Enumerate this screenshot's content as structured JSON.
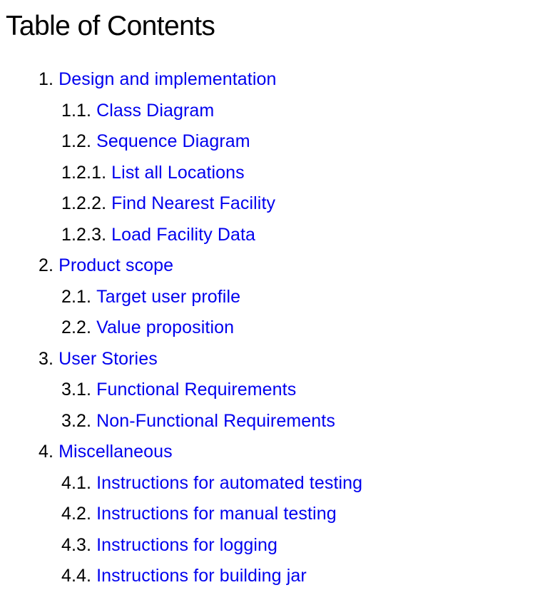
{
  "toc": {
    "title": "Table of Contents",
    "entries": [
      {
        "number": "1.",
        "label": "Design and implementation",
        "level": 1
      },
      {
        "number": "1.1.",
        "label": "Class Diagram",
        "level": 2
      },
      {
        "number": "1.2.",
        "label": "Sequence Diagram",
        "level": 2
      },
      {
        "number": "1.2.1.",
        "label": "List all Locations",
        "level": 3
      },
      {
        "number": "1.2.2.",
        "label": "Find Nearest Facility",
        "level": 3
      },
      {
        "number": "1.2.3.",
        "label": "Load Facility Data",
        "level": 3
      },
      {
        "number": "2.",
        "label": "Product scope",
        "level": 1
      },
      {
        "number": "2.1.",
        "label": "Target user profile",
        "level": 2
      },
      {
        "number": "2.2.",
        "label": "Value proposition",
        "level": 2
      },
      {
        "number": "3.",
        "label": "User Stories",
        "level": 1
      },
      {
        "number": "3.1.",
        "label": "Functional Requirements",
        "level": 2
      },
      {
        "number": "3.2.",
        "label": "Non-Functional Requirements",
        "level": 2
      },
      {
        "number": "4.",
        "label": "Miscellaneous",
        "level": 1
      },
      {
        "number": "4.1.",
        "label": "Instructions for automated testing",
        "level": 2
      },
      {
        "number": "4.2.",
        "label": "Instructions for manual testing",
        "level": 2
      },
      {
        "number": "4.3.",
        "label": "Instructions for logging",
        "level": 2
      },
      {
        "number": "4.4.",
        "label": "Instructions for building jar",
        "level": 2
      }
    ]
  },
  "colors": {
    "link": "#0000ee",
    "text": "#000000",
    "background": "#ffffff"
  }
}
